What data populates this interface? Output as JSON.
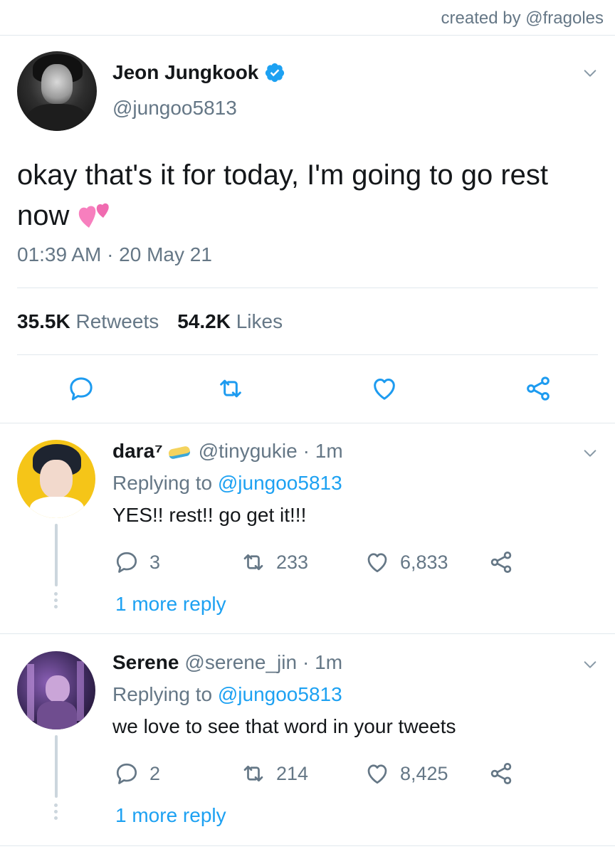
{
  "credit": "created by @fragoles",
  "tweet": {
    "name": "Jeon Jungkook",
    "handle": "@jungoo5813",
    "text": "okay that's it for today, I'm going to go rest now",
    "emoji": "two-hearts-emoji",
    "timestamp": "01:39 AM · 20 May 21",
    "retweets_count": "35.5K",
    "retweets_label": "Retweets",
    "likes_count": "54.2K",
    "likes_label": "Likes"
  },
  "replies": [
    {
      "name": "dara⁷",
      "badge": "🧽",
      "handle": "@tinygukie",
      "time": "· 1m",
      "replying_prefix": "Replying to",
      "replying_to": "@jungoo5813",
      "text": "YES!! rest!! go get it!!!",
      "reply_count": "3",
      "retweet_count": "233",
      "like_count": "6,833",
      "more": "1 more reply"
    },
    {
      "name": "Serene",
      "handle": "@serene_jin",
      "time": "· 1m",
      "replying_prefix": "Replying to",
      "replying_to": "@jungoo5813",
      "text": "we love to see that word in your tweets",
      "reply_count": "2",
      "retweet_count": "214",
      "like_count": "8,425",
      "more": "1 more reply"
    }
  ],
  "colors": {
    "accent": "#1da1f2",
    "secondary_text": "#657786",
    "divider": "#e1e8ed",
    "icon": "#1d9bf0"
  }
}
